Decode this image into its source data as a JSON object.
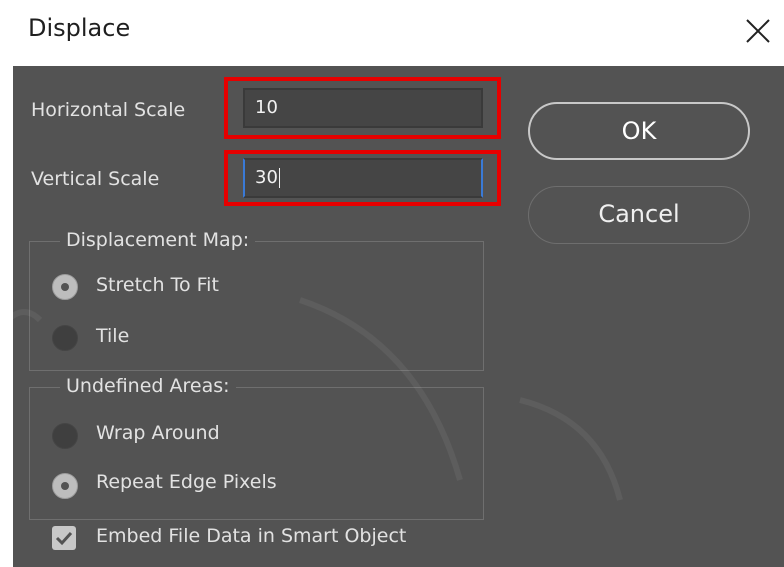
{
  "dialog": {
    "title": "Displace",
    "horizontal_scale": {
      "label": "Horizontal Scale",
      "value": "10"
    },
    "vertical_scale": {
      "label": "Vertical Scale",
      "value": "30"
    },
    "ok_label": "OK",
    "cancel_label": "Cancel",
    "displacement_map": {
      "legend": "Displacement Map:",
      "options": [
        {
          "label": "Stretch To Fit",
          "selected": true
        },
        {
          "label": "Tile",
          "selected": false
        }
      ]
    },
    "undefined_areas": {
      "legend": "Undefined Areas:",
      "options": [
        {
          "label": "Wrap Around",
          "selected": false
        },
        {
          "label": "Repeat Edge Pixels",
          "selected": true
        }
      ]
    },
    "embed_checkbox": {
      "label": "Embed File Data in Smart Object",
      "checked": true
    }
  },
  "colors": {
    "dialog_bg": "#535353",
    "highlight": "#e60000",
    "focus": "#3a7ad6"
  },
  "icons": [
    "close-icon",
    "radio-icon",
    "checkbox-icon"
  ]
}
